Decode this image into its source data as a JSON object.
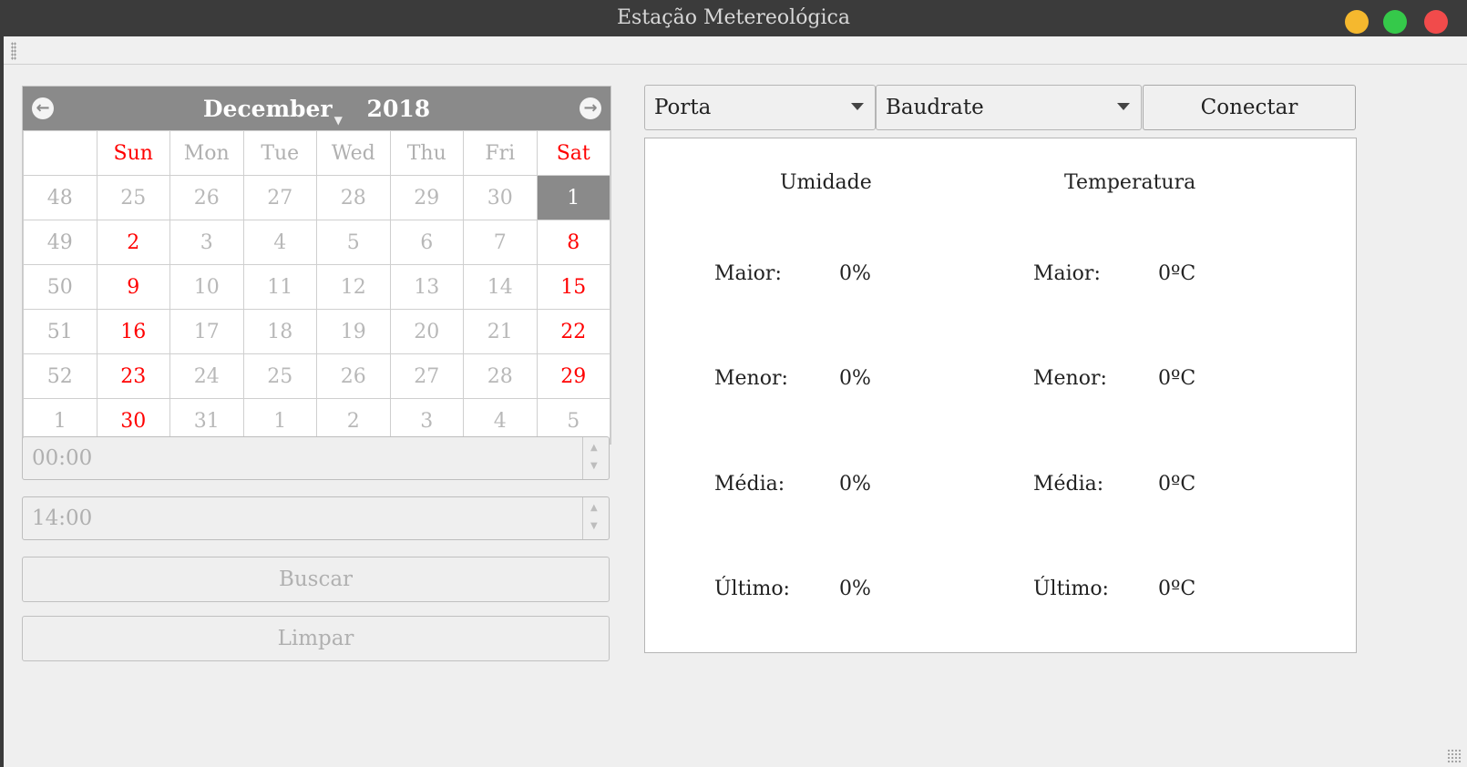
{
  "window": {
    "title": "Estação Metereológica"
  },
  "calendar": {
    "month": "December",
    "year": "2018",
    "weekdays": [
      "Sun",
      "Mon",
      "Tue",
      "Wed",
      "Thu",
      "Fri",
      "Sat"
    ],
    "selected_day": "1",
    "weeks": [
      {
        "num": "48",
        "days": [
          "25",
          "26",
          "27",
          "28",
          "29",
          "30",
          "1"
        ]
      },
      {
        "num": "49",
        "days": [
          "2",
          "3",
          "4",
          "5",
          "6",
          "7",
          "8"
        ]
      },
      {
        "num": "50",
        "days": [
          "9",
          "10",
          "11",
          "12",
          "13",
          "14",
          "15"
        ]
      },
      {
        "num": "51",
        "days": [
          "16",
          "17",
          "18",
          "19",
          "20",
          "21",
          "22"
        ]
      },
      {
        "num": "52",
        "days": [
          "23",
          "24",
          "25",
          "26",
          "27",
          "28",
          "29"
        ]
      },
      {
        "num": "1",
        "days": [
          "30",
          "31",
          "1",
          "2",
          "3",
          "4",
          "5"
        ]
      }
    ]
  },
  "time_start": {
    "value": "00:00"
  },
  "time_end": {
    "value": "14:00"
  },
  "buttons": {
    "search": "Buscar",
    "clear": "Limpar",
    "connect": "Conectar"
  },
  "port_select": {
    "selected": "Porta"
  },
  "baudrate_select": {
    "selected": "Baudrate"
  },
  "humidity": {
    "title": "Umidade",
    "rows": [
      {
        "label": "Maior:",
        "value": "0%"
      },
      {
        "label": "Menor:",
        "value": "0%"
      },
      {
        "label": "Média:",
        "value": "0%"
      },
      {
        "label": "Último:",
        "value": "0%"
      }
    ]
  },
  "temperature": {
    "title": "Temperatura",
    "rows": [
      {
        "label": "Maior:",
        "value": "0ºC"
      },
      {
        "label": "Menor:",
        "value": "0ºC"
      },
      {
        "label": "Média:",
        "value": "0ºC"
      },
      {
        "label": "Último:",
        "value": "0ºC"
      }
    ]
  }
}
